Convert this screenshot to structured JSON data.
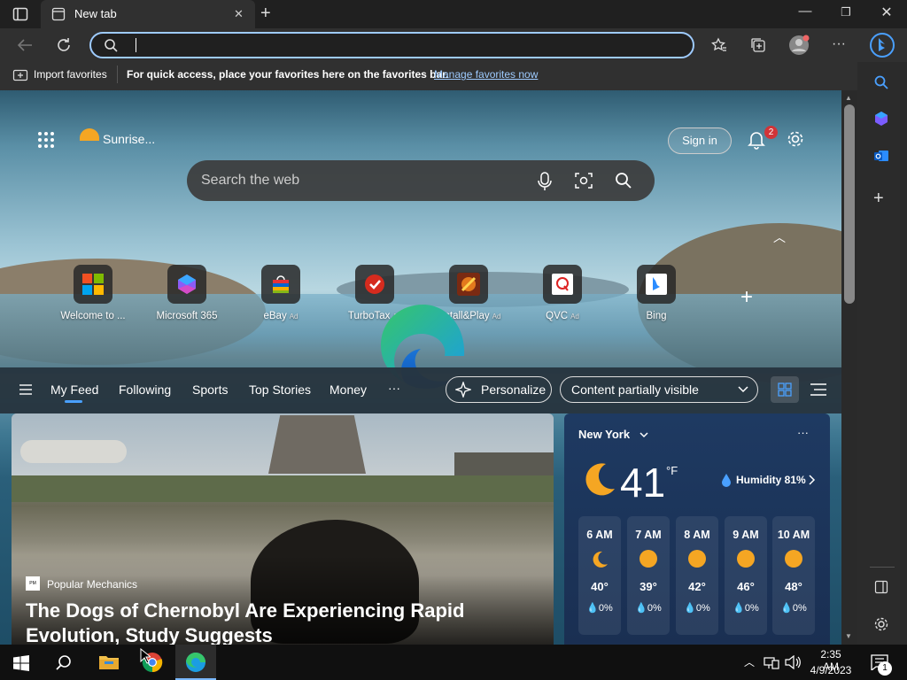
{
  "browser": {
    "tab_title": "New tab",
    "tab_close": "✕",
    "new_tab": "+",
    "address_value": ""
  },
  "favorites_bar": {
    "import_label": "Import favorites",
    "message": "For quick access, place your favorites here on the favorites bar.",
    "manage_link": "Manage favorites now"
  },
  "page": {
    "weather_short": "Sunrise...",
    "sign_in": "Sign in",
    "notification_count": "2",
    "search_placeholder": "Search the web",
    "quick_links": [
      {
        "label": "Welcome to ...",
        "ad": "",
        "icon": "microsoft-logo-icon"
      },
      {
        "label": "Microsoft 365",
        "ad": "",
        "icon": "microsoft-365-icon"
      },
      {
        "label": "eBay",
        "ad": "Ad",
        "icon": "ebay-bag-icon"
      },
      {
        "label": "TurboTax",
        "ad": "Ad",
        "icon": "turbotax-check-icon"
      },
      {
        "label": "Install&Play",
        "ad": "Ad",
        "icon": "game-icon"
      },
      {
        "label": "QVC",
        "ad": "Ad",
        "icon": "qvc-q-icon"
      },
      {
        "label": "Bing",
        "ad": "",
        "icon": "bing-b-icon"
      }
    ]
  },
  "feed": {
    "tabs": [
      "My Feed",
      "Following",
      "Sports",
      "Top Stories",
      "Money"
    ],
    "more": "···",
    "personalize": "Personalize",
    "content_visibility": "Content partially visible"
  },
  "article": {
    "source": "Popular Mechanics",
    "headline": "The Dogs of Chernobyl Are Experiencing Rapid Evolution, Study Suggests"
  },
  "weather": {
    "location": "New York",
    "more": "···",
    "temp": "41",
    "unit": "°F",
    "humidity": "Humidity 81%",
    "hourly": [
      {
        "time": "6 AM",
        "temp": "40°",
        "precip": "0%"
      },
      {
        "time": "7 AM",
        "temp": "39°",
        "precip": "0%"
      },
      {
        "time": "8 AM",
        "temp": "42°",
        "precip": "0%"
      },
      {
        "time": "9 AM",
        "temp": "46°",
        "precip": "0%"
      },
      {
        "time": "10 AM",
        "temp": "48°",
        "precip": "0%"
      }
    ]
  },
  "taskbar": {
    "time": "2:35 AM",
    "date": "4/9/2023",
    "notif_count": "1"
  },
  "colors": {
    "accent_link": "#9ecbff",
    "badge": "#d13438",
    "sun": "#f5a623"
  }
}
